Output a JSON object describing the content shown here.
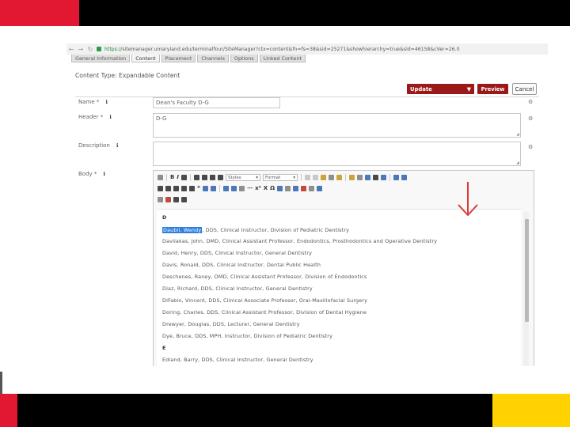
{
  "browser": {
    "url_scheme": "https://",
    "url_host": "sitemanager.umaryland.edu",
    "url_path": "/terminalfour/SiteManager?ctx=content&fn=fs=38&sid=25271&showhierarchy=true&sid=46158&cVer=26.0"
  },
  "tabs": [
    "General Information",
    "Content",
    "Placement",
    "Channels",
    "Options",
    "Linked Content"
  ],
  "content_type": "Content Type: Expandable Content",
  "buttons": {
    "update": "Update",
    "update_caret": "▼",
    "preview": "Preview",
    "cancel": "Cancel"
  },
  "fields": {
    "name": {
      "label": "Name *",
      "info": "ℹ",
      "value": "Dean's Faculty D-G"
    },
    "header": {
      "label": "Header *",
      "info": "ℹ",
      "value": "D-G"
    },
    "description": {
      "label": "Description",
      "info": "ℹ",
      "value": ""
    },
    "body": {
      "label": "Body *",
      "info": "ℹ"
    }
  },
  "row_icon": "⚙",
  "editor": {
    "styles_label": "Styles",
    "format_label": "Format",
    "bold_glyph": "B",
    "italic_glyph": "I",
    "quote_glyph": "❝",
    "ellipsis_glyph": "⋯",
    "x2_glyph": "x²",
    "x_glyph": "X",
    "omega_glyph": "Ω"
  },
  "body_content": {
    "letter_d": "D",
    "entries_d_first_name": "Daubil, Wendy",
    "entries_d_first_rest": ", DDS, Clinical Instructor, Division of Pediatric Dentistry",
    "entries_d": [
      "Davilakas, John, DMD, Clinical Assistant Professor, Endodontics, Prosthodontics and Operative Dentistry",
      "David, Henry, DDS, Clinical Instructor, General Dentistry",
      "Davis, Ronald, DDS, Clinical Instructor, Dental Public Health",
      "Deschenes, Raney, DMD, Clinical Assistant Professor, Division of Endodontics",
      "Diaz, Richard, DDS, Clinical Instructor, General Dentistry",
      "DiFabio, Vincent, DDS, Clinical Associate Professor, Oral-Maxillofacial Surgery",
      "Doring, Charles, DDS, Clinical Assistant Professor, Division of Dental Hygiene",
      "Drewyer, Douglas, DDS, Lecturer, General Dentistry",
      "Dye, Bruce, DDS, MPH, Instructor, Division of Pediatric Dentistry"
    ],
    "letter_e": "E",
    "entries_e": [
      "Edland, Barry, DDS, Clinical Instructor, General Dentistry"
    ]
  },
  "colors": {
    "slide_top_bar": "#000000",
    "slide_red": "#e21833",
    "slide_yellow": "#ffd200",
    "button_red": "#9c1919",
    "selection_blue": "#2f7ee0",
    "annotation_arrow": "#d83a3a"
  },
  "icons": {
    "back": "back-arrow-icon",
    "forward": "forward-arrow-icon",
    "reload": "reload-icon",
    "lock": "lock-icon",
    "annotation": "red-arrow-annotation"
  }
}
